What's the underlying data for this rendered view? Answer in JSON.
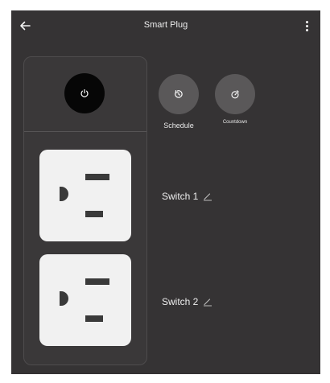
{
  "header": {
    "title": "Smart Plug"
  },
  "controls": {
    "schedule_label": "Schedule",
    "countdown_label": "Countdown"
  },
  "switches": [
    {
      "label": "Switch 1"
    },
    {
      "label": "Switch 2"
    }
  ],
  "colors": {
    "background": "#353334",
    "power_button": "#060606",
    "round_button": "#5a5859",
    "outlet_face": "#f1f1f1"
  },
  "icons": {
    "back": "arrow-left-icon",
    "more": "more-vertical-icon",
    "power": "power-icon",
    "schedule": "clock-icon",
    "countdown": "timer-icon",
    "edit": "pencil-icon"
  }
}
